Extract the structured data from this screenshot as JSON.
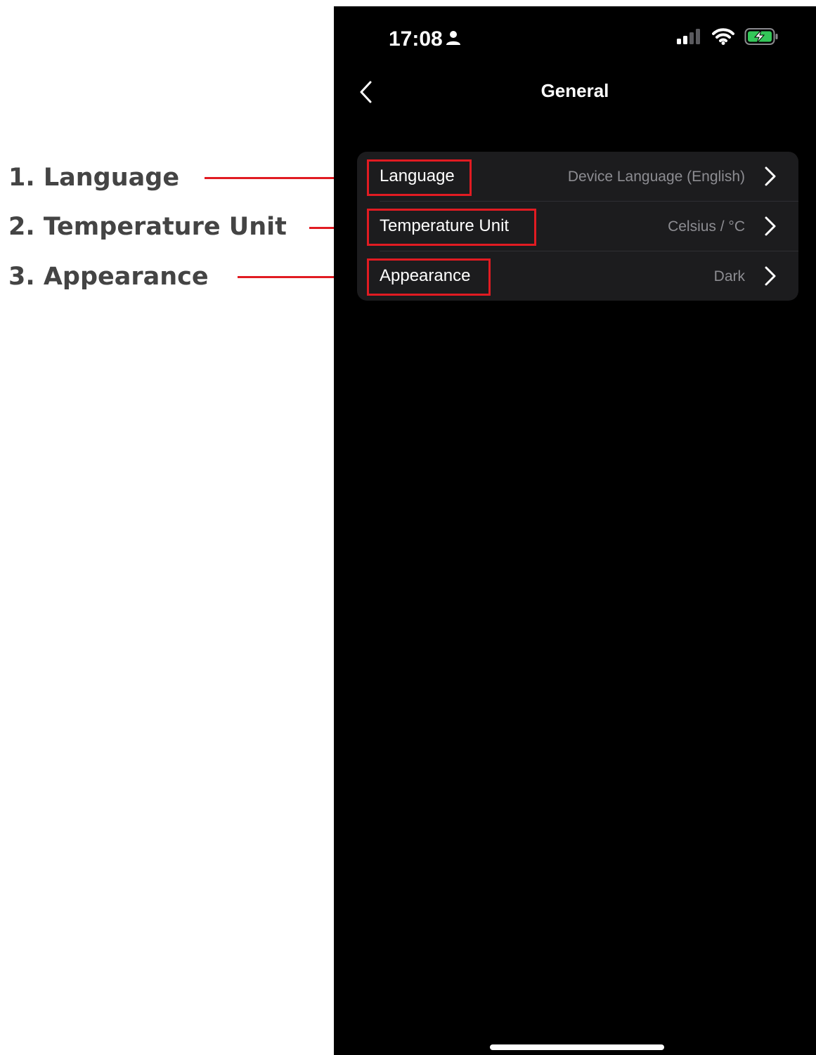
{
  "annotations": [
    {
      "label": "1. Language"
    },
    {
      "label": "2. Temperature Unit"
    },
    {
      "label": "3. Appearance"
    }
  ],
  "status_bar": {
    "time": "17:08",
    "icons": [
      "person-icon",
      "signal-icon",
      "wifi-icon",
      "battery-charging-icon"
    ]
  },
  "nav": {
    "back_icon": "chevron-left-icon",
    "title": "General"
  },
  "settings": {
    "rows": [
      {
        "label": "Language",
        "value": "Device Language (English)"
      },
      {
        "label": "Temperature Unit",
        "value": "Celsius / °C"
      },
      {
        "label": "Appearance",
        "value": "Dark"
      }
    ]
  },
  "colors": {
    "annotation_red": "#e11b22",
    "annotation_text": "#444444",
    "screen_background": "#000000",
    "card_background": "#1c1c1e",
    "value_text": "#8d8d92",
    "battery_green": "#34c759"
  }
}
